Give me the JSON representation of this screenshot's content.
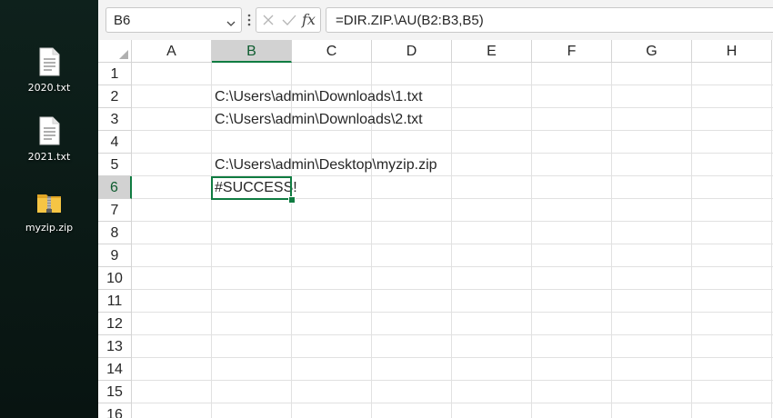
{
  "desktop": {
    "icons": [
      {
        "label": "2020.txt",
        "icon": "text-file-icon"
      },
      {
        "label": "2021.txt",
        "icon": "text-file-icon"
      },
      {
        "label": "myzip.zip",
        "icon": "zip-folder-icon"
      }
    ]
  },
  "formula_bar": {
    "name_box": "B6",
    "fx_label": "fx",
    "formula": "=DIR.ZIP.\\AU(B2:B3,B5)"
  },
  "grid": {
    "columns": [
      "A",
      "B",
      "C",
      "D",
      "E",
      "F",
      "G",
      "H"
    ],
    "rows": [
      "1",
      "2",
      "3",
      "4",
      "5",
      "6",
      "7",
      "8",
      "9",
      "10",
      "11",
      "12",
      "13",
      "14",
      "15",
      "16"
    ],
    "active_column": "B",
    "active_row": "6",
    "cells": {
      "B2": "C:\\Users\\admin\\Downloads\\1.txt",
      "B3": "C:\\Users\\admin\\Downloads\\2.txt",
      "B5": "C:\\Users\\admin\\Desktop\\myzip.zip",
      "B6": "#SUCCESS!"
    }
  },
  "colors": {
    "accent": "#107c41",
    "header_selected": "#d2d2d2",
    "gridline": "#e1e1e1"
  }
}
